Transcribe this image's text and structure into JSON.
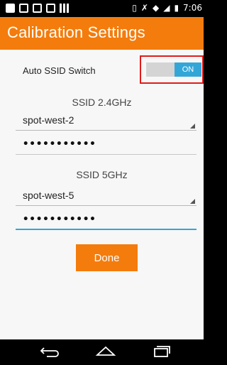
{
  "status_bar": {
    "time": "7:06",
    "left_icons": [
      "photo-icon",
      "image-icon",
      "mail-icon",
      "sd-card-icon",
      "barcode-icon"
    ],
    "right_icons": [
      "vibrate-icon",
      "bluetooth-icon",
      "wifi-icon",
      "signal-icon",
      "battery-icon"
    ]
  },
  "app_bar": {
    "title": "Calibration Settings",
    "color": "#f47c0c"
  },
  "auto_switch": {
    "label": "Auto SSID Switch",
    "state_label": "ON",
    "on": true,
    "on_color": "#33a6d8",
    "highlight_color": "#e01b1b"
  },
  "ssid_24": {
    "heading": "SSID 2.4GHz",
    "selected": "spot-west-2",
    "password_masked": "•••••••••••"
  },
  "ssid_5": {
    "heading": "SSID 5GHz",
    "selected": "spot-west-5",
    "password_masked": "•••••••••••"
  },
  "done_button": {
    "label": "Done"
  },
  "nav_bar": {
    "items": [
      "back-icon",
      "home-icon",
      "recents-icon"
    ]
  }
}
